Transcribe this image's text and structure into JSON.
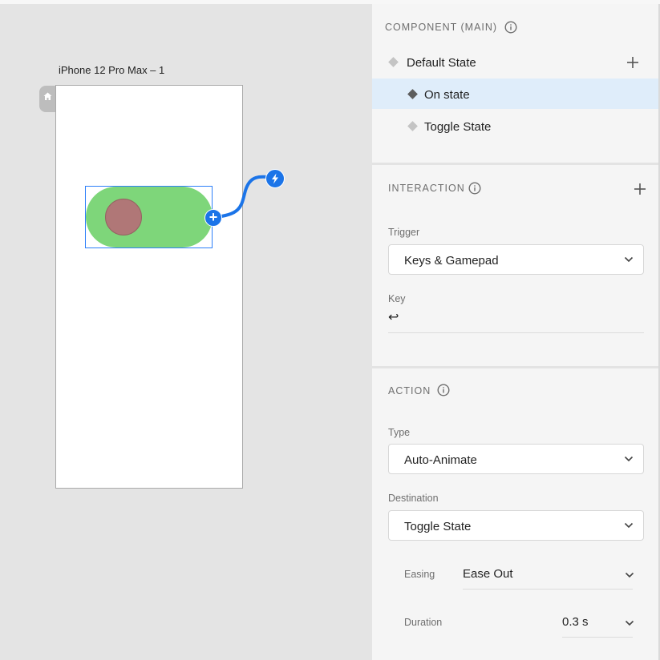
{
  "canvas": {
    "artboard_title": "iPhone 12 Pro Max – 1",
    "icons": {
      "home": "home-icon",
      "add": "plus-icon",
      "trigger": "lightning-bolt-icon"
    }
  },
  "component": {
    "header": "COMPONENT (MAIN)",
    "states": [
      {
        "label": "Default State",
        "selected": false
      },
      {
        "label": "On state",
        "selected": true
      },
      {
        "label": "Toggle State",
        "selected": false
      }
    ]
  },
  "interaction": {
    "header": "INTERACTION",
    "trigger_label": "Trigger",
    "trigger_value": "Keys & Gamepad",
    "key_label": "Key",
    "key_value": "↩"
  },
  "action": {
    "header": "ACTION",
    "type_label": "Type",
    "type_value": "Auto-Animate",
    "destination_label": "Destination",
    "destination_value": "Toggle State",
    "easing_label": "Easing",
    "easing_value": "Ease Out",
    "duration_label": "Duration",
    "duration_value": "0.3 s"
  },
  "colors": {
    "accent": "#1b74e8",
    "selection": "#2d7ff9",
    "toggle_track": "#7ed67a",
    "toggle_knob": "#b07777",
    "selected_row": "#dfedfa"
  }
}
